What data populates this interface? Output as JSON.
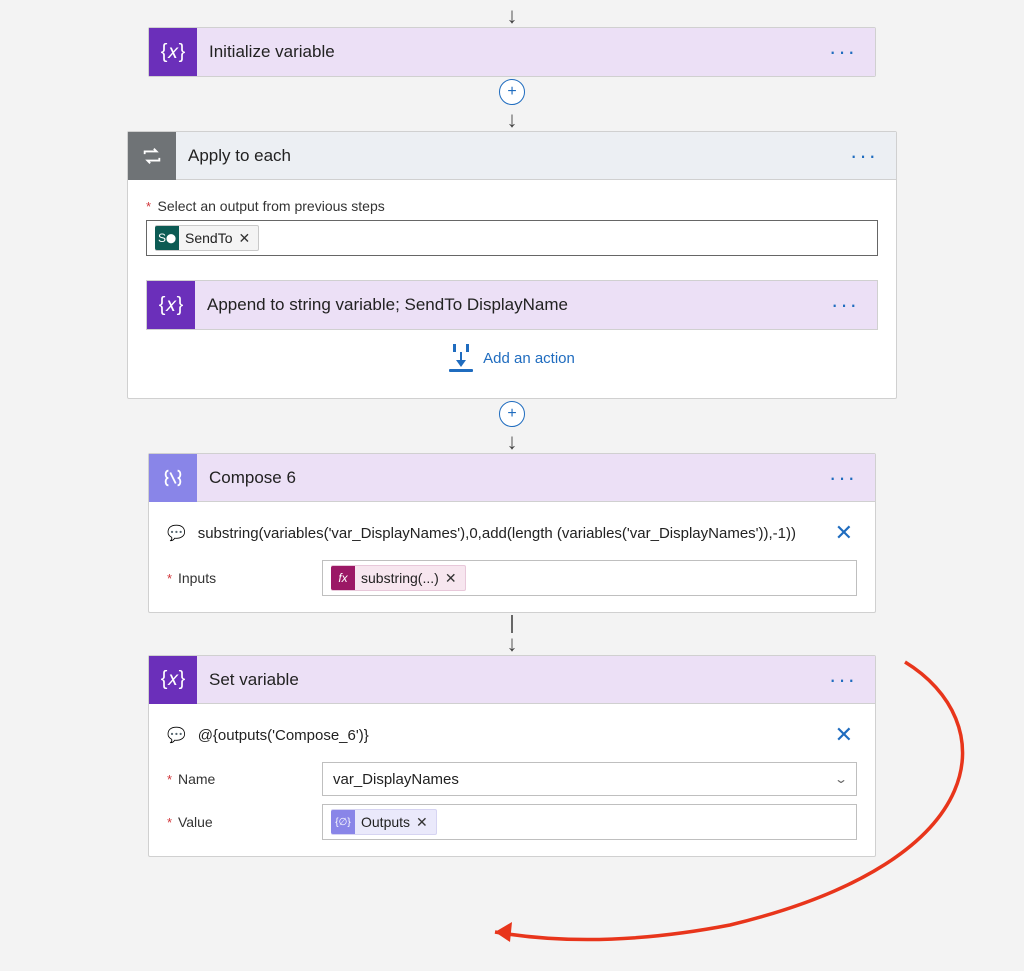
{
  "cards": {
    "init": {
      "title": "Initialize variable"
    },
    "apply": {
      "title": "Apply to each",
      "select_label": "Select an output from previous steps",
      "token_sendto": "SendTo",
      "append_title": "Append to string variable; SendTo DisplayName",
      "add_action": "Add an action"
    },
    "compose": {
      "title": "Compose 6",
      "peek_code": "substring(variables('var_DisplayNames'),0,add(length (variables('var_DisplayNames')),-1))",
      "inputs_label": "Inputs",
      "token_sub": "substring(...)"
    },
    "setvar": {
      "title": "Set variable",
      "peek_code": "@{outputs('Compose_6')}",
      "name_label": "Name",
      "name_value": "var_DisplayNames",
      "value_label": "Value",
      "token_outputs": "Outputs"
    }
  }
}
